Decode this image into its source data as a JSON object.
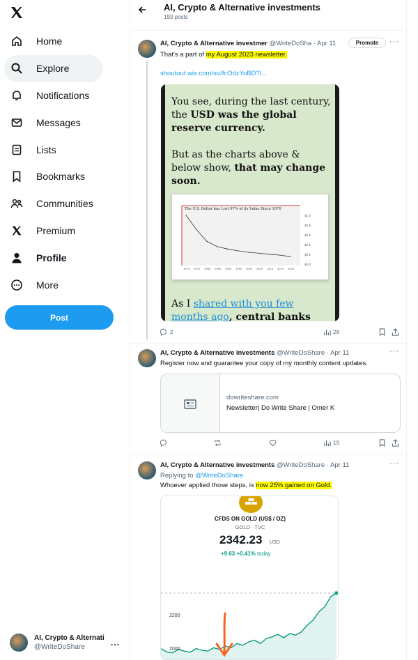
{
  "sidebar": {
    "logo": "X",
    "items": [
      {
        "label": "Home",
        "icon": "home-icon"
      },
      {
        "label": "Explore",
        "icon": "search-icon",
        "active": true
      },
      {
        "label": "Notifications",
        "icon": "bell-icon"
      },
      {
        "label": "Messages",
        "icon": "envelope-icon"
      },
      {
        "label": "Lists",
        "icon": "list-icon"
      },
      {
        "label": "Bookmarks",
        "icon": "bookmark-icon"
      },
      {
        "label": "Communities",
        "icon": "communities-icon"
      },
      {
        "label": "Premium",
        "icon": "x-logo-icon"
      },
      {
        "label": "Profile",
        "icon": "person-icon",
        "bold": true
      },
      {
        "label": "More",
        "icon": "more-circle-icon"
      }
    ],
    "post_button": "Post",
    "account": {
      "name": "AI, Crypto & Alternati",
      "handle": "@WriteDoShare",
      "more": "..."
    }
  },
  "header": {
    "back_icon": "arrow-left-icon",
    "title": "AI, Crypto & Alternative investments",
    "subtitle": "193 posts"
  },
  "tweets": [
    {
      "name": "AI, Crypto & Alternative investmer",
      "handle": "@WriteDoSha",
      "date": "· Apr 11",
      "promote": "Promote",
      "text_before": "That's a part of ",
      "text_highlight": "my August 2023 newsletter.",
      "link": "shoutout.wix.com/so/fcOdzYoBD?l...",
      "media_text": {
        "p1_a": "You see, during the last century,",
        "p1_b": "the ",
        "p1_bold1": "USD was the global",
        "p1_bold2": "reserve currency.",
        "p2_a": "But as the charts above &",
        "p2_b": "below show, ",
        "p2_bold": "that may change",
        "p2_bold2": "soon.",
        "p3_a": "As I ",
        "p3_link1": "shared with you few",
        "p3_link2": "months ago",
        "p3_bold": ", central banks"
      },
      "chart_title": "The U.S. Dollar has Lost 97% of its Value Since 1970",
      "actions": {
        "replies": "2",
        "views": "28"
      }
    },
    {
      "name": "AI, Crypto & Alternative investments",
      "handle": "@WriteDoShare",
      "date": "· Apr 11",
      "text": "Register now and guarantee your copy of my monthly content updates.",
      "card": {
        "domain": "dowriteshare.com",
        "title": "Newsletter| Do Write Share | Omer K"
      },
      "actions": {
        "views": "19"
      }
    },
    {
      "name": "AI, Crypto & Alternative investments",
      "handle": "@WriteDoShare",
      "date": "· Apr 11",
      "replying_prefix": "Replying to ",
      "replying_to": "@WriteDoShare",
      "text_before": "Whoever applied those steps, is ",
      "text_highlight": "now 25% gained on Gold.",
      "gold": {
        "title": "CFDS ON GOLD (US$ / OZ)",
        "sub": "GOLD · TVC",
        "price": "2342.23",
        "currency": "USD",
        "change_abs": "+9.63",
        "change_pct": "+0.41%",
        "change_label": "today",
        "ticks": [
          "2200",
          "2000"
        ]
      }
    }
  ],
  "chart_data": [
    {
      "type": "line",
      "title": "The U.S. Dollar has Lost 97% of its Value Since 1970",
      "x": [
        1970,
        1975,
        1980,
        1985,
        1990,
        1995,
        2000,
        2005,
        2010,
        2015,
        2020
      ],
      "values": [
        1.0,
        0.7,
        0.45,
        0.34,
        0.29,
        0.25,
        0.22,
        0.2,
        0.18,
        0.16,
        0.13
      ],
      "y_ticks": [
        "$1.0",
        "$0.8",
        "$0.6",
        "$0.4",
        "$0.2",
        "$0.0"
      ],
      "ylim": [
        0,
        1.0
      ]
    },
    {
      "type": "area",
      "title": "CFDS ON GOLD (US$ / OZ)",
      "values": [
        2010,
        1990,
        1985,
        2005,
        1995,
        1988,
        2010,
        2000,
        1995,
        2015,
        2005,
        2025,
        2015,
        2040,
        2030,
        2050,
        2060,
        2040,
        2070,
        2080,
        2095,
        2075,
        2100,
        2090,
        2110,
        2150,
        2180,
        2230,
        2260,
        2320,
        2342
      ],
      "y_ticks": [
        2200,
        2000
      ],
      "color": "#089981"
    }
  ],
  "colors": {
    "accent": "#1d9bf0",
    "highlight": "#fffb00",
    "gold_green": "#089981",
    "arrow": "#f26522"
  }
}
